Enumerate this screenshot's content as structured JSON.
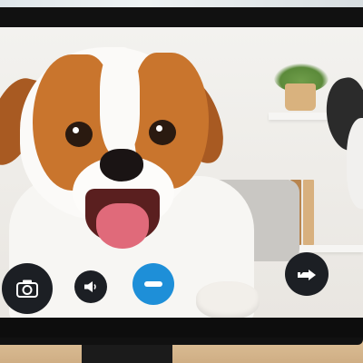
{
  "call": {
    "controls": [
      {
        "name": "camera",
        "icon": "camera-icon"
      },
      {
        "name": "speaker",
        "icon": "speaker-icon"
      },
      {
        "name": "end-call",
        "icon": "minus-icon"
      },
      {
        "name": "share",
        "icon": "share-icon"
      }
    ]
  },
  "colors": {
    "end_call_accent": "#1e8fd8",
    "control_background": "#1c1f24"
  }
}
